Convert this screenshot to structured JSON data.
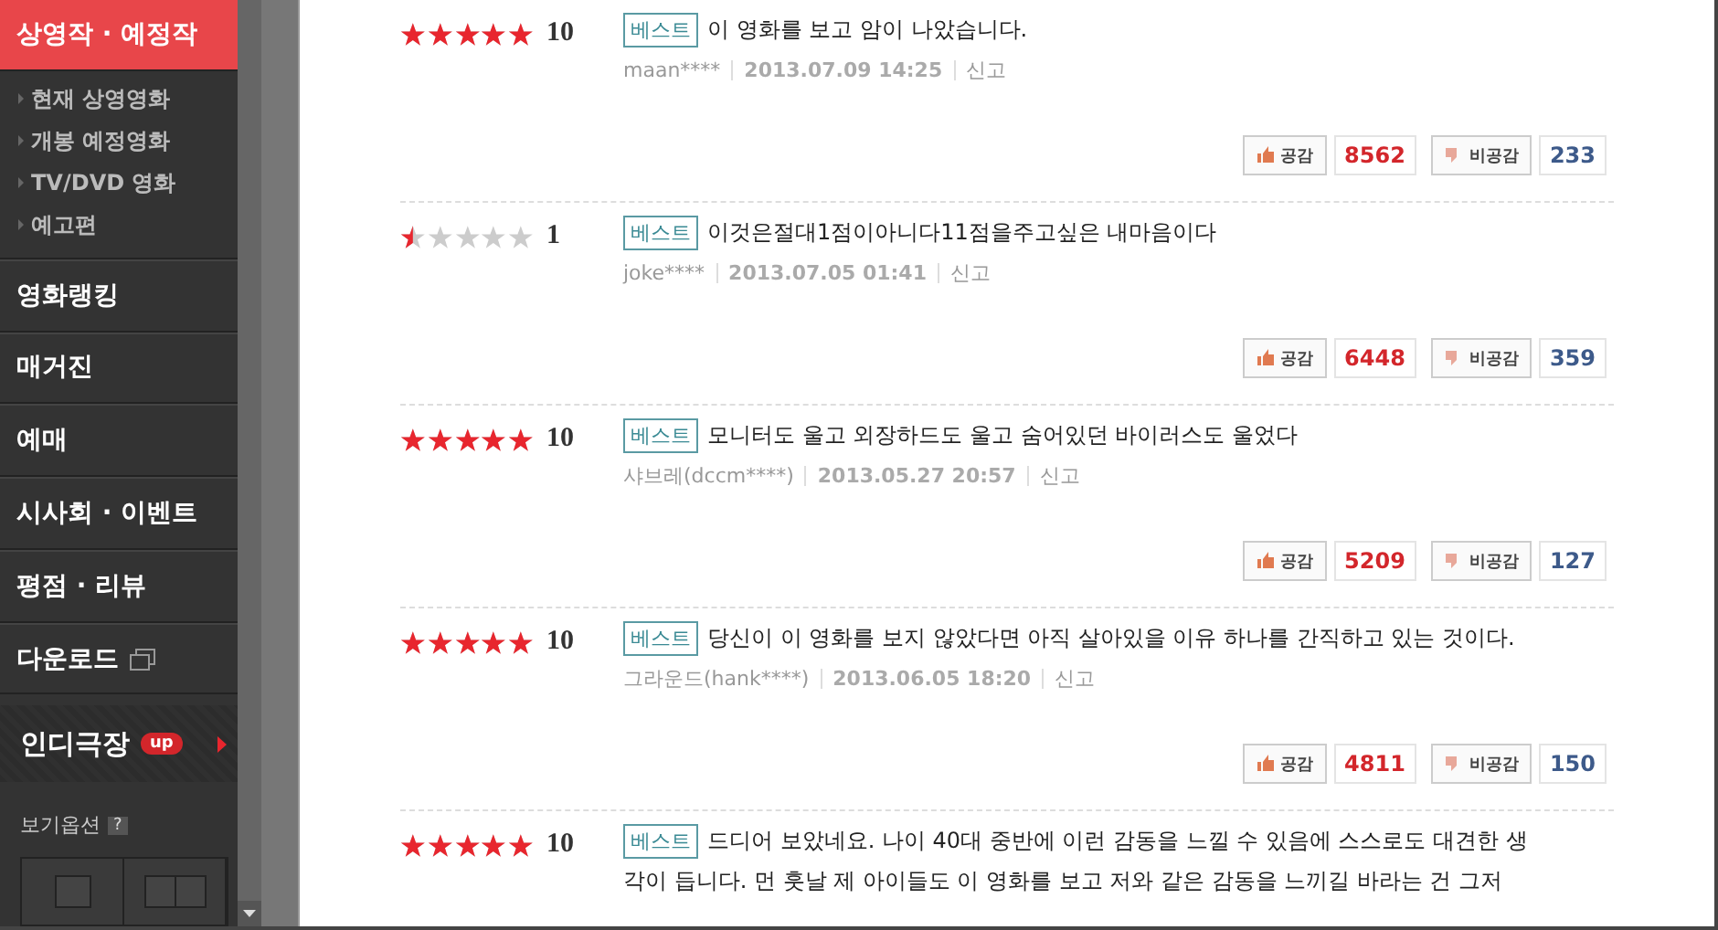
{
  "sidebar": {
    "active": {
      "label": "상영작 · 예정작",
      "selected": true
    },
    "subitems": [
      "현재 상영영화",
      "개봉 예정영화",
      "TV/DVD 영화",
      "예고편"
    ],
    "items": [
      {
        "label": "영화랭킹",
        "kind": "plain"
      },
      {
        "label": "매거진",
        "kind": "plain"
      },
      {
        "label": "예매",
        "kind": "plain"
      },
      {
        "label": "시사회 · 이벤트",
        "kind": "plain"
      },
      {
        "label": "평점 · 리뷰",
        "kind": "plain"
      },
      {
        "label": "다운로드",
        "kind": "popup"
      }
    ],
    "indie": {
      "label": "인디극장",
      "badge": "up"
    },
    "view_options": {
      "label": "보기옵션",
      "help": "?"
    }
  },
  "reviews": [
    {
      "stars": 5,
      "score": "10",
      "badge": "베스트",
      "lines": [
        "이 영화를 보고 암이 나았습니다."
      ],
      "author": "maan****",
      "date": "2013.07.09 14:25",
      "report": "신고",
      "like": "공감",
      "likes": "8562",
      "dislike": "비공감",
      "dislikes": "233"
    },
    {
      "stars": 0.5,
      "score": "1",
      "badge": "베스트",
      "lines": [
        "이것은절대1점이아니다11점을주고싶은 내마음이다"
      ],
      "author": "joke****",
      "date": "2013.07.05 01:41",
      "report": "신고",
      "like": "공감",
      "likes": "6448",
      "dislike": "비공감",
      "dislikes": "359"
    },
    {
      "stars": 5,
      "score": "10",
      "badge": "베스트",
      "lines": [
        "모니터도 울고 외장하드도 울고 숨어있던 바이러스도 울었다"
      ],
      "author": "샤브레(dccm****)",
      "date": "2013.05.27 20:57",
      "report": "신고",
      "like": "공감",
      "likes": "5209",
      "dislike": "비공감",
      "dislikes": "127"
    },
    {
      "stars": 5,
      "score": "10",
      "badge": "베스트",
      "lines": [
        "당신이 이 영화를 보지 않았다면 아직 살아있을 이유 하나를 간직하고 있는 것이다."
      ],
      "author": "그라운드(hank****)",
      "date": "2013.06.05 18:20",
      "report": "신고",
      "like": "공감",
      "likes": "4811",
      "dislike": "비공감",
      "dislikes": "150"
    },
    {
      "stars": 5,
      "score": "10",
      "badge": "베스트",
      "lines": [
        "드디어 보았네요. 나이 40대 중반에 이런 감동을 느낄 수 있음에 스스로도 대견한 생",
        "각이 듭니다. 먼 훗날 제 아이들도 이 영화를 보고 저와 같은 감동을 느끼길 바라는 건 그저"
      ]
    }
  ]
}
